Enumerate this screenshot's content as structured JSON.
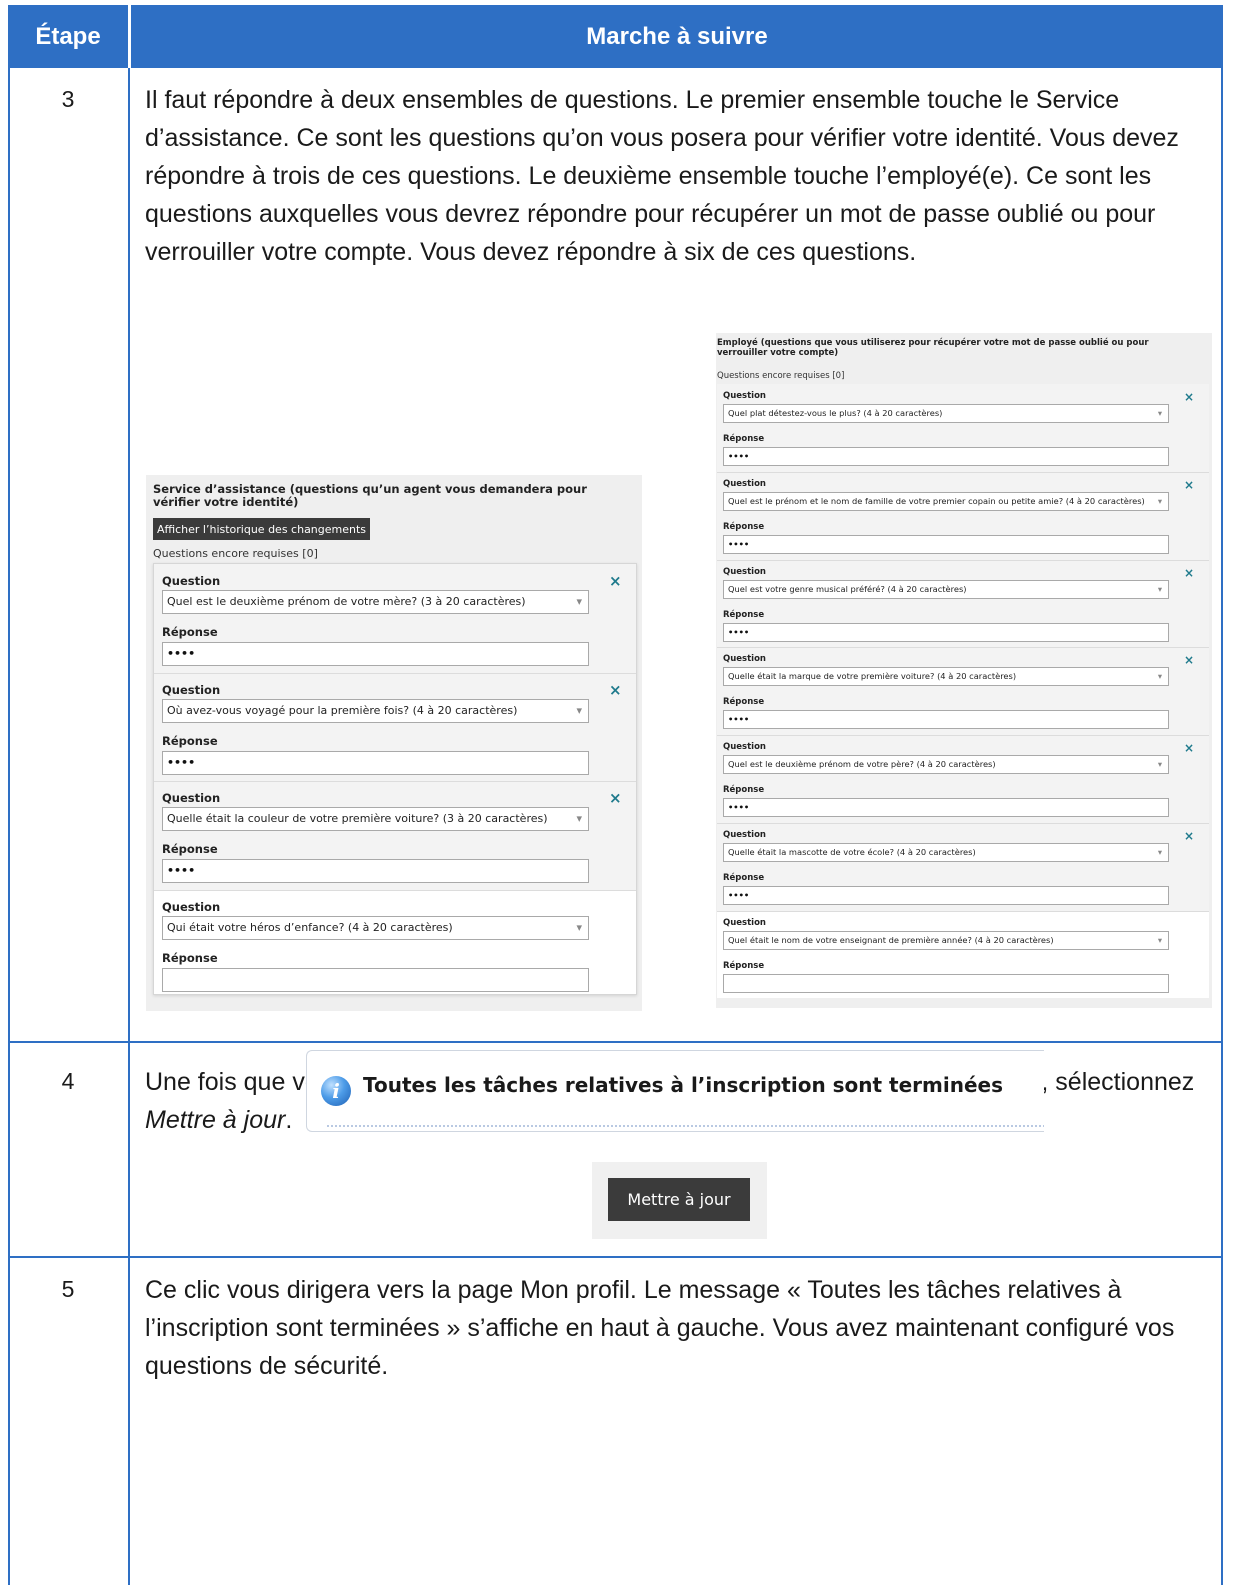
{
  "table": {
    "col_step": "Étape",
    "col_procedure": "Marche à suivre"
  },
  "rows": [
    {
      "step": "3",
      "text": "Il faut répondre à deux ensembles de questions. Le premier ensemble touche le Service d’assistance. Ce sont les questions qu’on vous posera pour vérifier votre identité. Vous devez répondre à trois de ces questions. Le deuxième ensemble touche l’employé(e). Ce sont les questions auxquelles vous devrez répondre pour récupérer un mot de passe oublié ou pour verrouiller votre compte. Vous devez répondre à six de ces questions."
    },
    {
      "step": "4",
      "text_before": "Une fois que vous avez sélectionné et répondu au nombre de questions requises, sélectionnez ",
      "text_em": "Mettre à jour",
      "text_after": "."
    },
    {
      "step": "5",
      "text": "Ce clic vous dirigera vers la page Mon profil. Le message « Toutes les tâches relatives à l’inscription sont terminées » s’affiche en haut à gauche. Vous avez maintenant configuré vos questions de sécurité."
    }
  ],
  "helpdesk_panel": {
    "title": "Service d’assistance (questions qu’un agent vous demandera pour vérifier votre identité)",
    "history_button": "Afficher l’historique des changements",
    "required": "Questions encore requises [0]",
    "question_label": "Question",
    "answer_label": "Réponse",
    "remove_icon": "×",
    "dropdown_icon": "▾",
    "items": [
      {
        "question": "Quel est le deuxième prénom de votre mère? (3 à 20 caractères)",
        "answer": "••••",
        "removable": true
      },
      {
        "question": "Où avez-vous voyagé pour la première fois? (4 à 20 caractères)",
        "answer": "••••",
        "removable": true
      },
      {
        "question": "Quelle était la couleur de votre première voiture? (3 à 20 caractères)",
        "answer": "••••",
        "removable": true
      },
      {
        "question": "Qui était votre héros d’enfance? (4 à 20 caractères)",
        "answer": "",
        "removable": false
      }
    ]
  },
  "employee_panel": {
    "title": "Employé (questions que vous utiliserez pour récupérer votre mot de passe oublié ou pour verrouiller votre compte)",
    "required": "Questions encore requises [0]",
    "question_label": "Question",
    "answer_label": "Réponse",
    "remove_icon": "×",
    "dropdown_icon": "▾",
    "items": [
      {
        "question": "Quel plat détestez-vous le plus? (4 à 20 caractères)",
        "answer": "••••",
        "removable": true
      },
      {
        "question": "Quel est le prénom et le nom de famille de votre premier copain ou petite amie? (4 à 20 caractères)",
        "answer": "••••",
        "removable": true
      },
      {
        "question": "Quel est votre genre musical préféré? (4 à 20 caractères)",
        "answer": "••••",
        "removable": true
      },
      {
        "question": "Quelle était la marque de votre première voiture? (4 à 20 caractères)",
        "answer": "••••",
        "removable": true
      },
      {
        "question": "Quel est le deuxième prénom de votre père? (4 à 20 caractères)",
        "answer": "••••",
        "removable": true
      },
      {
        "question": "Quelle était la mascotte de votre école? (4 à 20 caractères)",
        "answer": "••••",
        "removable": true
      },
      {
        "question": "Quel était le nom de votre enseignant de première année? (4 à 20 caractères)",
        "answer": "",
        "removable": false
      }
    ]
  },
  "update_button": "Mettre à jour",
  "info_banner": {
    "icon": "info-icon",
    "glyph": "i",
    "text": "Toutes les tâches relatives à l’inscription sont terminées"
  },
  "colors": {
    "header_blue": "#2e6fc4",
    "dark_button": "#3b3b3b",
    "remove_teal": "#1f7a8c"
  }
}
